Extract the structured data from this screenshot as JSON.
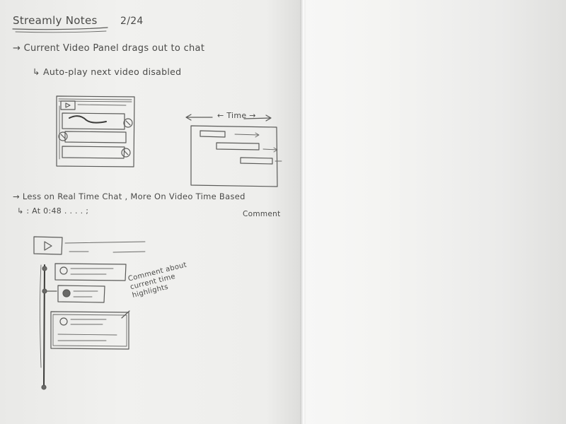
{
  "notebook": {
    "title": "Streamly Notes",
    "date": "2/24",
    "notes": [
      "→ Current Video Panel drags out to chat",
      "↳ Auto-play next video disabled",
      "→ Less on Real Time Chat , More On Video Time Based",
      "↳ : At 0:48 . . . . ;",
      "Comment"
    ],
    "sketch_labels": {
      "time": "← Time →",
      "annotation": "Comment about current time highlights"
    }
  }
}
